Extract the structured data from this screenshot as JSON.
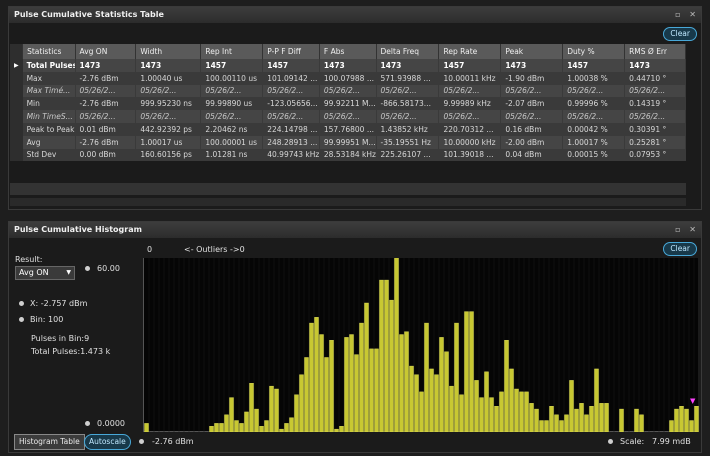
{
  "stats_panel": {
    "title": "Pulse Cumulative Statistics Table",
    "clear_label": "Clear",
    "columns": [
      "Statistics",
      "Avg ON",
      "Width",
      "Rep Int",
      "P-P F Diff",
      "F Abs",
      "Delta Freq",
      "Rep Rate",
      "Peak",
      "Duty %",
      "RMS Ø Err"
    ],
    "rows": [
      {
        "style": "bold",
        "arrow": "▶",
        "cells": [
          "Total Pulses",
          "1473",
          "1473",
          "1457",
          "1457",
          "1473",
          "1473",
          "1457",
          "1473",
          "1457",
          "1473"
        ]
      },
      {
        "style": "normal",
        "arrow": "",
        "cells": [
          "Max",
          "-2.76 dBm",
          "1.00040 us",
          "100.00110 us",
          "101.09142 ...",
          "100.07988 ...",
          "571.93988 ...",
          "10.00011 kHz",
          "-1.90 dBm",
          "1.00038 %",
          "0.44710 °"
        ]
      },
      {
        "style": "italic",
        "arrow": "",
        "cells": [
          "Max Timé...",
          "05/26/2...",
          "05/26/2...",
          "05/26/2...",
          "05/26/2...",
          "05/26/2...",
          "05/26/2...",
          "05/26/2...",
          "05/26/2...",
          "05/26/2...",
          "05/26/2..."
        ]
      },
      {
        "style": "normal",
        "arrow": "",
        "cells": [
          "Min",
          "-2.76 dBm",
          "999.95230 ns",
          "99.99890 us",
          "-123.05656...",
          "99.92211 M...",
          "-866.58173...",
          "9.99989 kHz",
          "-2.07 dBm",
          "0.99996 %",
          "0.14319 °"
        ]
      },
      {
        "style": "italic",
        "arrow": "",
        "cells": [
          "Min TimeS...",
          "05/26/2...",
          "05/26/2...",
          "05/26/2...",
          "05/26/2...",
          "05/26/2...",
          "05/26/2...",
          "05/26/2...",
          "05/26/2...",
          "05/26/2...",
          "05/26/2..."
        ]
      },
      {
        "style": "normal",
        "arrow": "",
        "cells": [
          "Peak to Peak",
          "0.01 dBm",
          "442.92392 ps",
          "2.20462 ns",
          "224.14798 ...",
          "157.76800 ...",
          "1.43852 kHz",
          "220.70312 ...",
          "0.16 dBm",
          "0.00042 %",
          "0.30391 °"
        ]
      },
      {
        "style": "normal",
        "arrow": "",
        "cells": [
          "Avg",
          "-2.76 dBm",
          "1.00017 us",
          "100.00001 us",
          "248.28913 ...",
          "99.99951 M...",
          "-35.19551 Hz",
          "10.00000 kHz",
          "-2.00 dBm",
          "1.00017 %",
          "0.25281 °"
        ]
      },
      {
        "style": "normal",
        "arrow": "",
        "cells": [
          "Std Dev",
          "0.00 dBm",
          "160.60156 ps",
          "1.01281 ns",
          "40.99743 kHz",
          "28.53184 kHz",
          "225.26107 ...",
          "101.39018 ...",
          "0.04 dBm",
          "0.00015 %",
          "0.07953 °"
        ]
      }
    ]
  },
  "histogram_panel": {
    "title": "Pulse Cumulative Histogram",
    "clear_label": "Clear",
    "result_label": "Result:",
    "result_value": "Avg ON",
    "y_max": "60.00",
    "y_min": "0.0000",
    "x_readout": "X:  -2.757 dBm",
    "bin_readout": "Bin:  100",
    "pulses_in_bin": "Pulses in Bin:9",
    "total_pulses": "Total Pulses:1.473 k",
    "histogram_table_label": "Histogram Table",
    "autoscale_label": "Autoscale",
    "x_start": "-2.76 dBm",
    "scale_label": "Scale:",
    "scale_value": "7.99 mdB",
    "outliers_left": "0",
    "outliers_text": "<- Outliers ->0",
    "window_buttons": [
      "▫",
      "✕"
    ],
    "bar_color": "#c8c832",
    "bar_counts": [
      3,
      0,
      0,
      0,
      0,
      0,
      0,
      0,
      0,
      0,
      0,
      0,
      0,
      2,
      3,
      3,
      6,
      12,
      4,
      3,
      7,
      17,
      8,
      2,
      4,
      16,
      15,
      1,
      3,
      5,
      13,
      20,
      26,
      38,
      40,
      34,
      26,
      32,
      1,
      2,
      33,
      34,
      27,
      38,
      45,
      29,
      29,
      53,
      53,
      46,
      62,
      34,
      35,
      23,
      20,
      14,
      38,
      22,
      20,
      33,
      28,
      16,
      38,
      13,
      42,
      42,
      18,
      12,
      21,
      12,
      9,
      14,
      32,
      22,
      15,
      14,
      14,
      10,
      8,
      4,
      4,
      9,
      6,
      4,
      6,
      18,
      8,
      10,
      6,
      9,
      22,
      10,
      10,
      0,
      0,
      8,
      0,
      0,
      8,
      6,
      0,
      0,
      0,
      0,
      0,
      4,
      8,
      9,
      8,
      4,
      9
    ]
  }
}
